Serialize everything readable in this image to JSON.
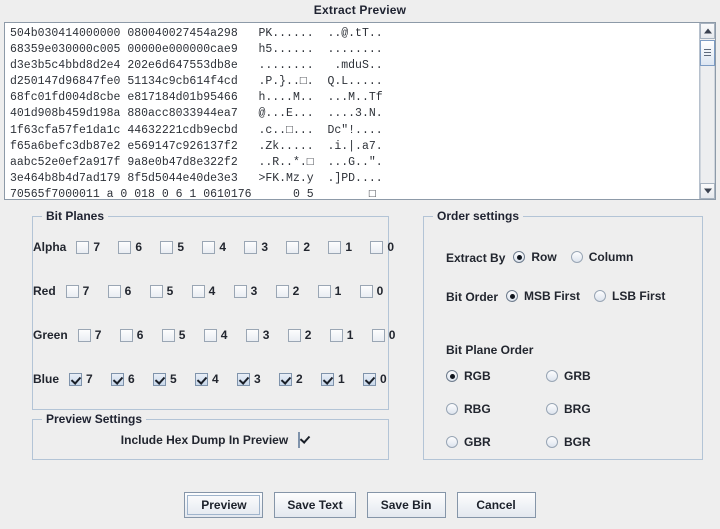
{
  "dialog": {
    "title": "Extract Preview"
  },
  "preview": {
    "scrollbar": {
      "up_icon": "triangle-up-icon",
      "down_icon": "triangle-down-icon"
    },
    "hex_lines": [
      "504b030414000000 080040027454a298   PK......  ..@.tT..",
      "68359e030000c005 00000e000000cae9   h5......  ........",
      "d3e3b5c4bbd8d2e4 202e6d647553db8e   ........   .mduS..",
      "d250147d96847fe0 51134c9cb614f4cd   .P.}..□.  Q.L.....",
      "68fc01fd004d8cbe e817184d01b95466   h....M..  ...M..Tf",
      "401d908b459d198a 880acc8033944ea7   @...E...  ....3.N.",
      "1f63cfa57fe1da1c 44632221cdb9ecbd   .c..□...  Dc\"!....",
      "f65a6befc3db87e2 e569147c926137f2   .Zk.....  .i.|.a7.",
      "aabc52e0ef2a917f 9a8e0b47d8e322f2   ..R..*.□  ...G..\".",
      "3e464b8b4d7ad179 8f5d5044e40de3e3   >FK.Mz.y  .]PD....",
      "70565f7000011 a 0 018 0 6 1 0610176      0 5        □"
    ]
  },
  "bit_planes": {
    "title": "Bit Planes",
    "bit_labels": [
      "7",
      "6",
      "5",
      "4",
      "3",
      "2",
      "1",
      "0"
    ],
    "channels": [
      {
        "name": "Alpha",
        "checked": [
          false,
          false,
          false,
          false,
          false,
          false,
          false,
          false
        ]
      },
      {
        "name": "Red",
        "checked": [
          false,
          false,
          false,
          false,
          false,
          false,
          false,
          false
        ]
      },
      {
        "name": "Green",
        "checked": [
          false,
          false,
          false,
          false,
          false,
          false,
          false,
          false
        ]
      },
      {
        "name": "Blue",
        "checked": [
          true,
          true,
          true,
          true,
          true,
          true,
          true,
          true
        ]
      }
    ]
  },
  "order_settings": {
    "title": "Order settings",
    "extract_by": {
      "caption": "Extract By",
      "options": [
        {
          "label": "Row",
          "selected": true
        },
        {
          "label": "Column",
          "selected": false
        }
      ]
    },
    "bit_order": {
      "caption": "Bit Order",
      "options": [
        {
          "label": "MSB First",
          "selected": true
        },
        {
          "label": "LSB First",
          "selected": false
        }
      ]
    },
    "bit_plane_order": {
      "caption": "Bit Plane Order",
      "options": [
        {
          "label": "RGB",
          "selected": true
        },
        {
          "label": "GRB",
          "selected": false
        },
        {
          "label": "RBG",
          "selected": false
        },
        {
          "label": "BRG",
          "selected": false
        },
        {
          "label": "GBR",
          "selected": false
        },
        {
          "label": "BGR",
          "selected": false
        }
      ]
    }
  },
  "preview_settings": {
    "title": "Preview Settings",
    "include_hex_dump": {
      "label": "Include Hex Dump In Preview",
      "checked": true
    }
  },
  "buttons": [
    {
      "label": "Preview",
      "focused": true
    },
    {
      "label": "Save Text",
      "focused": false
    },
    {
      "label": "Save Bin",
      "focused": false
    },
    {
      "label": "Cancel",
      "focused": false
    }
  ]
}
